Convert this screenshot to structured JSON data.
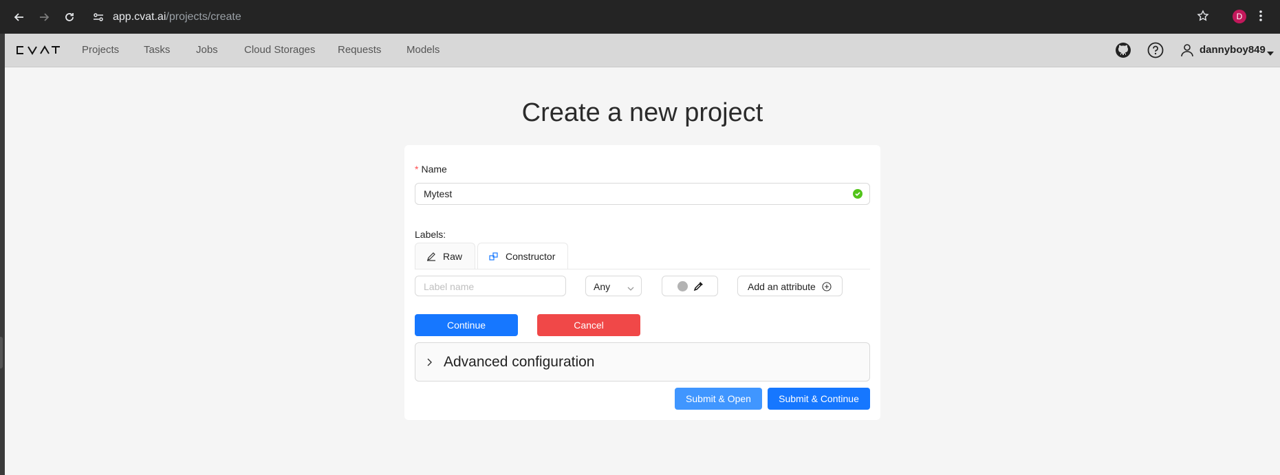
{
  "browser": {
    "url_host": "app.cvat.ai",
    "url_path": "/projects/create",
    "profile_initial": "D"
  },
  "header": {
    "logo": "CVAT",
    "nav": [
      "Projects",
      "Tasks",
      "Jobs",
      "Cloud Storages",
      "Requests",
      "Models"
    ],
    "username": "dannyboy849"
  },
  "page": {
    "title": "Create a new project"
  },
  "form": {
    "name_label": "Name",
    "required_mark": "*",
    "name_value": "Mytest",
    "labels_title": "Labels:",
    "tabs": [
      {
        "label": "Raw",
        "icon": "pencil-icon",
        "active": false
      },
      {
        "label": "Constructor",
        "icon": "build-icon",
        "active": true
      }
    ],
    "label_name_placeholder": "Label name",
    "shape_type": "Any",
    "color_swatch": "#b3b3b3",
    "add_attribute": "Add an attribute",
    "continue": "Continue",
    "cancel": "Cancel",
    "advanced": "Advanced configuration",
    "submit_open": "Submit & Open",
    "submit_continue": "Submit & Continue"
  },
  "colors": {
    "primary": "#1677ff",
    "danger": "#f04848",
    "success": "#52c41a"
  }
}
